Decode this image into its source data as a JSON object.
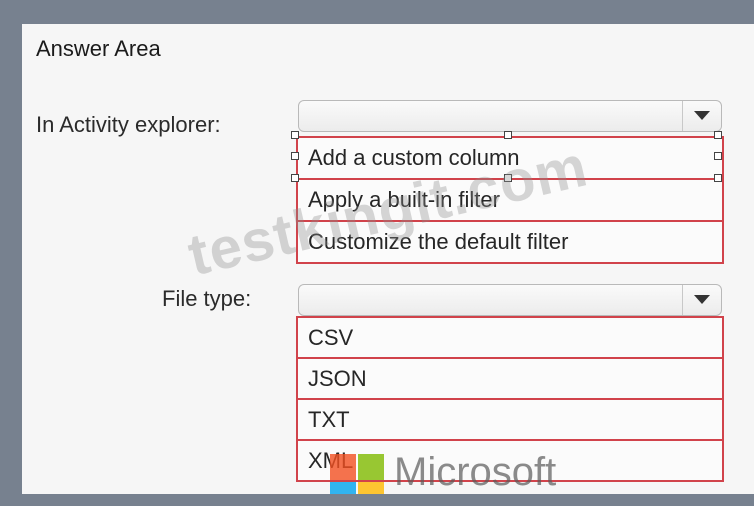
{
  "title": "Answer Area",
  "activity": {
    "label": "In Activity explorer:",
    "selected": "",
    "options": [
      "Add a custom column",
      "Apply a built-in filter",
      "Customize the default filter"
    ]
  },
  "filetype": {
    "label": "File type:",
    "selected": "",
    "options": [
      "CSV",
      "JSON",
      "TXT",
      "XML"
    ]
  },
  "watermark": "testkingit.com",
  "logo_text": "Microsoft",
  "colors": {
    "frame": "#77818f",
    "panel": "#f6f6f6",
    "option_border": "#d1434b",
    "ms_red": "#f25022",
    "ms_green": "#7fba00",
    "ms_blue": "#00a4ef",
    "ms_yellow": "#ffb900"
  }
}
